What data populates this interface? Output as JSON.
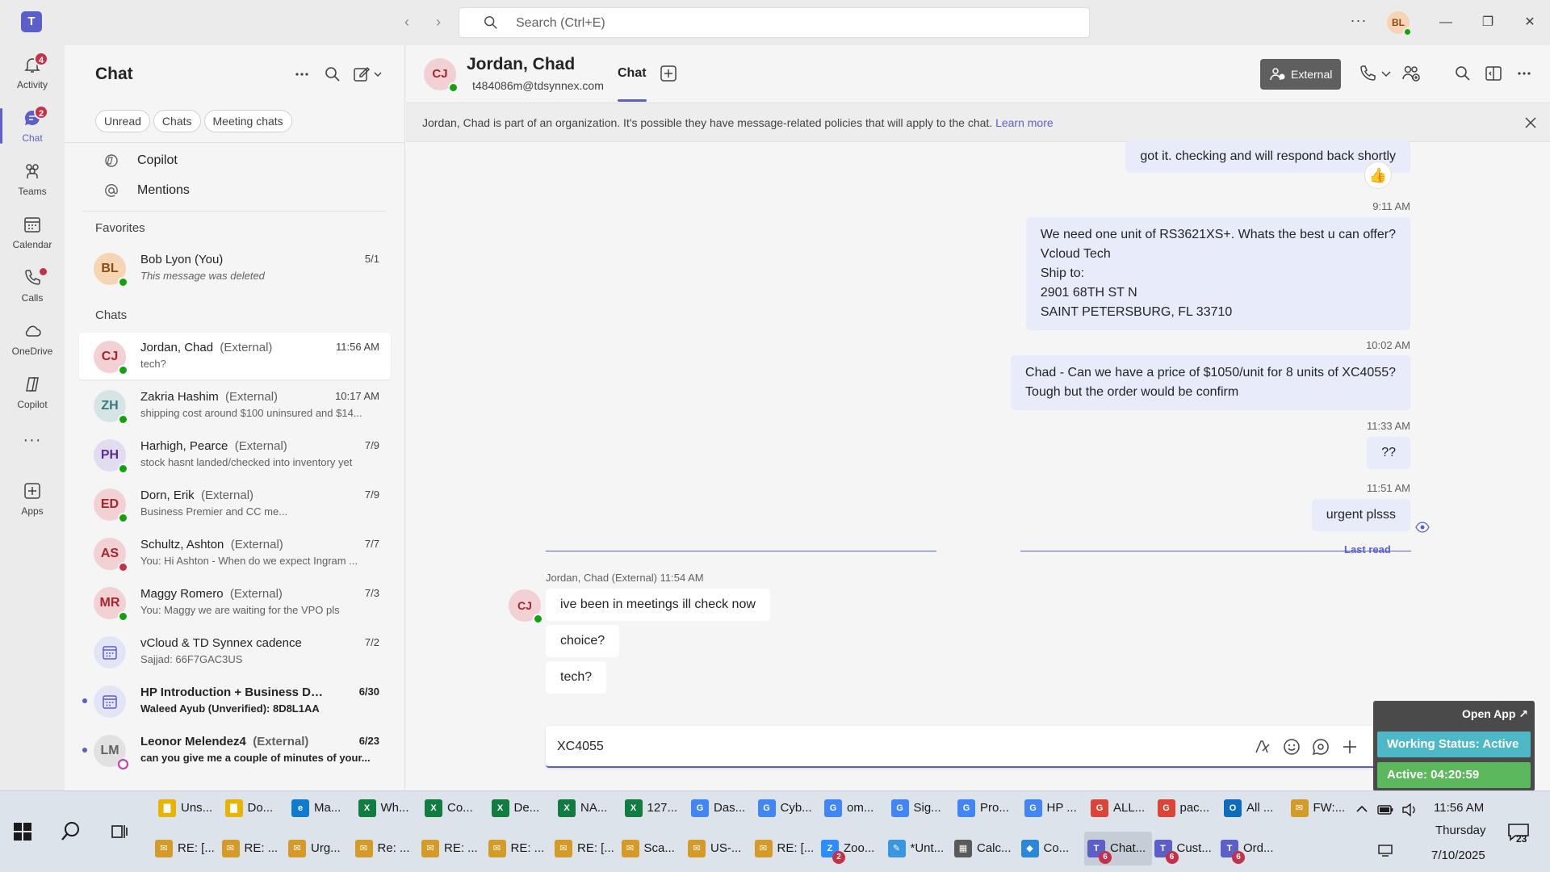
{
  "titlebar": {
    "search_placeholder": "Search (Ctrl+E)",
    "user_initials": "BL"
  },
  "rail": {
    "items": [
      {
        "label": "Activity",
        "badge": "4"
      },
      {
        "label": "Chat",
        "badge": "2"
      },
      {
        "label": "Teams"
      },
      {
        "label": "Calendar"
      },
      {
        "label": "Calls"
      },
      {
        "label": "OneDrive"
      },
      {
        "label": "Copilot"
      },
      {
        "label": "Apps"
      }
    ],
    "more": "···"
  },
  "chatlist": {
    "title": "Chat",
    "filters": [
      "Unread",
      "Chats",
      "Meeting chats"
    ],
    "special": [
      "Copilot",
      "Mentions"
    ],
    "favorites_label": "Favorites",
    "chats_label": "Chats",
    "favorites": [
      {
        "initials": "BL",
        "name": "Bob Lyon (You)",
        "preview": "This message was deleted",
        "time": "5/1"
      }
    ],
    "chats": [
      {
        "initials": "CJ",
        "name": "Jordan, Chad",
        "tag": "(External)",
        "preview": "tech?",
        "time": "11:56 AM"
      },
      {
        "initials": "ZH",
        "name": "Zakria Hashim",
        "tag": "(External)",
        "preview": "shipping cost around $100 uninsured and $14...",
        "time": "10:17 AM"
      },
      {
        "initials": "PH",
        "name": "Harhigh, Pearce",
        "tag": "(External)",
        "preview": "stock hasnt landed/checked into inventory yet",
        "time": "7/9"
      },
      {
        "initials": "ED",
        "name": "Dorn, Erik",
        "tag": "(External)",
        "preview": "Business Premier and CC me...",
        "time": "7/9"
      },
      {
        "initials": "AS",
        "name": "Schultz, Ashton",
        "tag": "(External)",
        "preview": "You: Hi Ashton - When do we expect Ingram ...",
        "time": "7/7"
      },
      {
        "initials": "MR",
        "name": "Maggy Romero",
        "tag": "(External)",
        "preview": "You: Maggy we are waiting for the VPO pls",
        "time": "7/3"
      },
      {
        "name": "vCloud & TD Synnex cadence",
        "tag": "",
        "preview": "Sajjad: 66F7GAC3US",
        "time": "7/2"
      },
      {
        "name": "HP Introduction + Business Dis...",
        "tag": "",
        "preview": "Waleed Ayub (Unverified): 8D8L1AA",
        "time": "6/30"
      },
      {
        "initials": "LM",
        "name": "Leonor Melendez4",
        "tag": "(External)",
        "preview": "can you give me a couple of minutes of your...",
        "time": "6/23"
      }
    ]
  },
  "header": {
    "initials": "CJ",
    "name": "Jordan, Chad",
    "email": "t484086m@tdsynnex.com",
    "tab": "Chat",
    "external_label": "External"
  },
  "banner": {
    "text": "Jordan, Chad is part of an organization. It's possible they have message-related policies that will apply to the chat.",
    "link": "Learn more"
  },
  "messages": {
    "out": [
      {
        "text": "got it. checking and will respond back shortly"
      },
      {
        "time": "9:11 AM",
        "lines": [
          "We need one unit of RS3621XS+. Whats the best u can offer?",
          "Vcloud Tech",
          "Ship to:",
          "2901 68TH ST N",
          "SAINT PETERSBURG, FL 33710"
        ]
      },
      {
        "time": "10:02 AM",
        "lines": [
          "Chad -  Can we have a price of $1050/unit for 8 units of XC4055?",
          "Tough but the order would be confirm"
        ]
      },
      {
        "time": "11:33 AM",
        "text": "??"
      },
      {
        "time": "11:51 AM",
        "text": "urgent plsss"
      }
    ],
    "reaction": "👍",
    "last_read": "Last read",
    "incoming_initials": "CJ",
    "incoming_meta": "Jordan, Chad (External)  11:54 AM",
    "in": [
      "ive been in meetings  ill check now",
      "choice?",
      "tech?"
    ]
  },
  "composer": {
    "value": "XC4055"
  },
  "widget": {
    "open_app": "Open App ↗",
    "working_status": "Working Status: Active",
    "active_timer": "Active: 04:20:59"
  },
  "taskbar": {
    "row1": [
      {
        "label": "Uns...",
        "color": "#e8b400",
        "glyph": "▇"
      },
      {
        "label": "Do...",
        "color": "#e8b400",
        "glyph": "▇"
      },
      {
        "label": "Ma...",
        "color": "#0f7bcf",
        "glyph": "e"
      },
      {
        "label": "Wh...",
        "color": "#107c41",
        "glyph": "X"
      },
      {
        "label": "Co...",
        "color": "#107c41",
        "glyph": "X"
      },
      {
        "label": "De...",
        "color": "#107c41",
        "glyph": "X"
      },
      {
        "label": "NA...",
        "color": "#107c41",
        "glyph": "X"
      },
      {
        "label": "127...",
        "color": "#107c41",
        "glyph": "X"
      },
      {
        "label": "Das...",
        "color": "#4285f4",
        "glyph": "G"
      },
      {
        "label": "Cyb...",
        "color": "#4285f4",
        "glyph": "G"
      },
      {
        "label": "om...",
        "color": "#4285f4",
        "glyph": "G"
      },
      {
        "label": "Sig...",
        "color": "#4285f4",
        "glyph": "G"
      },
      {
        "label": "Pro...",
        "color": "#4285f4",
        "glyph": "G"
      },
      {
        "label": "HP ...",
        "color": "#4285f4",
        "glyph": "G"
      },
      {
        "label": "ALL...",
        "color": "#db4437",
        "glyph": "G"
      },
      {
        "label": "pac...",
        "color": "#db4437",
        "glyph": "G"
      },
      {
        "label": "All ...",
        "color": "#0f6cbd",
        "glyph": "O"
      },
      {
        "label": "FW:...",
        "color": "#d49b29",
        "glyph": "✉"
      }
    ],
    "row2": [
      {
        "label": "RE: [...",
        "color": "#d49b29",
        "glyph": "✉"
      },
      {
        "label": "RE: ...",
        "color": "#d49b29",
        "glyph": "✉"
      },
      {
        "label": "Urg...",
        "color": "#d49b29",
        "glyph": "✉"
      },
      {
        "label": "Re: ...",
        "color": "#d49b29",
        "glyph": "✉"
      },
      {
        "label": "RE: ...",
        "color": "#d49b29",
        "glyph": "✉"
      },
      {
        "label": "RE: ...",
        "color": "#d49b29",
        "glyph": "✉"
      },
      {
        "label": "RE: [...",
        "color": "#d49b29",
        "glyph": "✉"
      },
      {
        "label": "Sca...",
        "color": "#d49b29",
        "glyph": "✉"
      },
      {
        "label": "US-...",
        "color": "#d49b29",
        "glyph": "✉"
      },
      {
        "label": "RE: [...",
        "color": "#d49b29",
        "glyph": "✉"
      },
      {
        "label": "Zoo...",
        "color": "#2d8cff",
        "glyph": "Z",
        "badge": "2"
      },
      {
        "label": "*Unt...",
        "color": "#3a96dd",
        "glyph": "✎"
      },
      {
        "label": "Calc...",
        "color": "#5a5a5a",
        "glyph": "▦"
      },
      {
        "label": "Co...",
        "color": "#2b88d8",
        "glyph": "◆"
      },
      {
        "label": "Chat...",
        "color": "#5b5fc7",
        "glyph": "T",
        "badge": "6",
        "active": true
      },
      {
        "label": "Cust...",
        "color": "#5b5fc7",
        "glyph": "T",
        "badge": "6"
      },
      {
        "label": "Ord...",
        "color": "#5b5fc7",
        "glyph": "T",
        "badge": "6"
      }
    ],
    "time": "11:56 AM",
    "day": "Thursday",
    "date": "7/10/2025",
    "notifications": "23"
  },
  "colors": {
    "accent": "#5b5fc7",
    "presence_available": "#13a10e",
    "presence_busy": "#c4314b",
    "bubble_out": "#e8ebfa"
  }
}
